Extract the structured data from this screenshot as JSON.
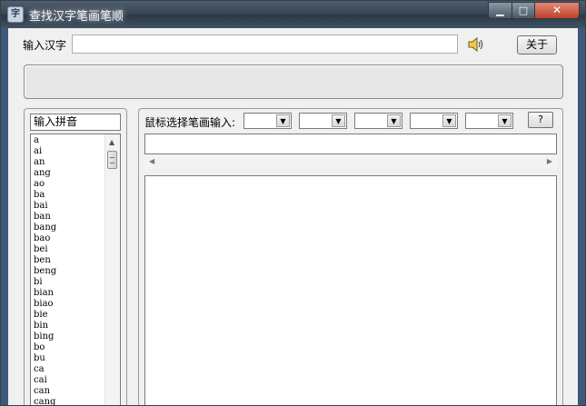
{
  "window": {
    "title": "查找汉字笔画笔顺",
    "minimize_glyph": "▁",
    "maximize_glyph": "□",
    "close_glyph": "✕"
  },
  "top_row": {
    "hanzi_label": "输入汉字",
    "hanzi_value": "",
    "speaker_icon": "speaker-icon",
    "about_label": "关于"
  },
  "pinyin_panel": {
    "input_value": "输入拼音",
    "items": [
      "a",
      "ai",
      "an",
      "ang",
      "ao",
      "ba",
      "bai",
      "ban",
      "bang",
      "bao",
      "bei",
      "ben",
      "beng",
      "bi",
      "bian",
      "biao",
      "bie",
      "bin",
      "bing",
      "bo",
      "bu",
      "ca",
      "cai",
      "can",
      "cang"
    ],
    "scroll_up_glyph": "▲"
  },
  "stroke_panel": {
    "mouse_label": "鼠标选择笔画输入:",
    "combo_glyph": "▼",
    "help_label": "?",
    "stroke_value": "",
    "scroll_left_glyph": "◀",
    "scroll_right_glyph": "▶"
  }
}
